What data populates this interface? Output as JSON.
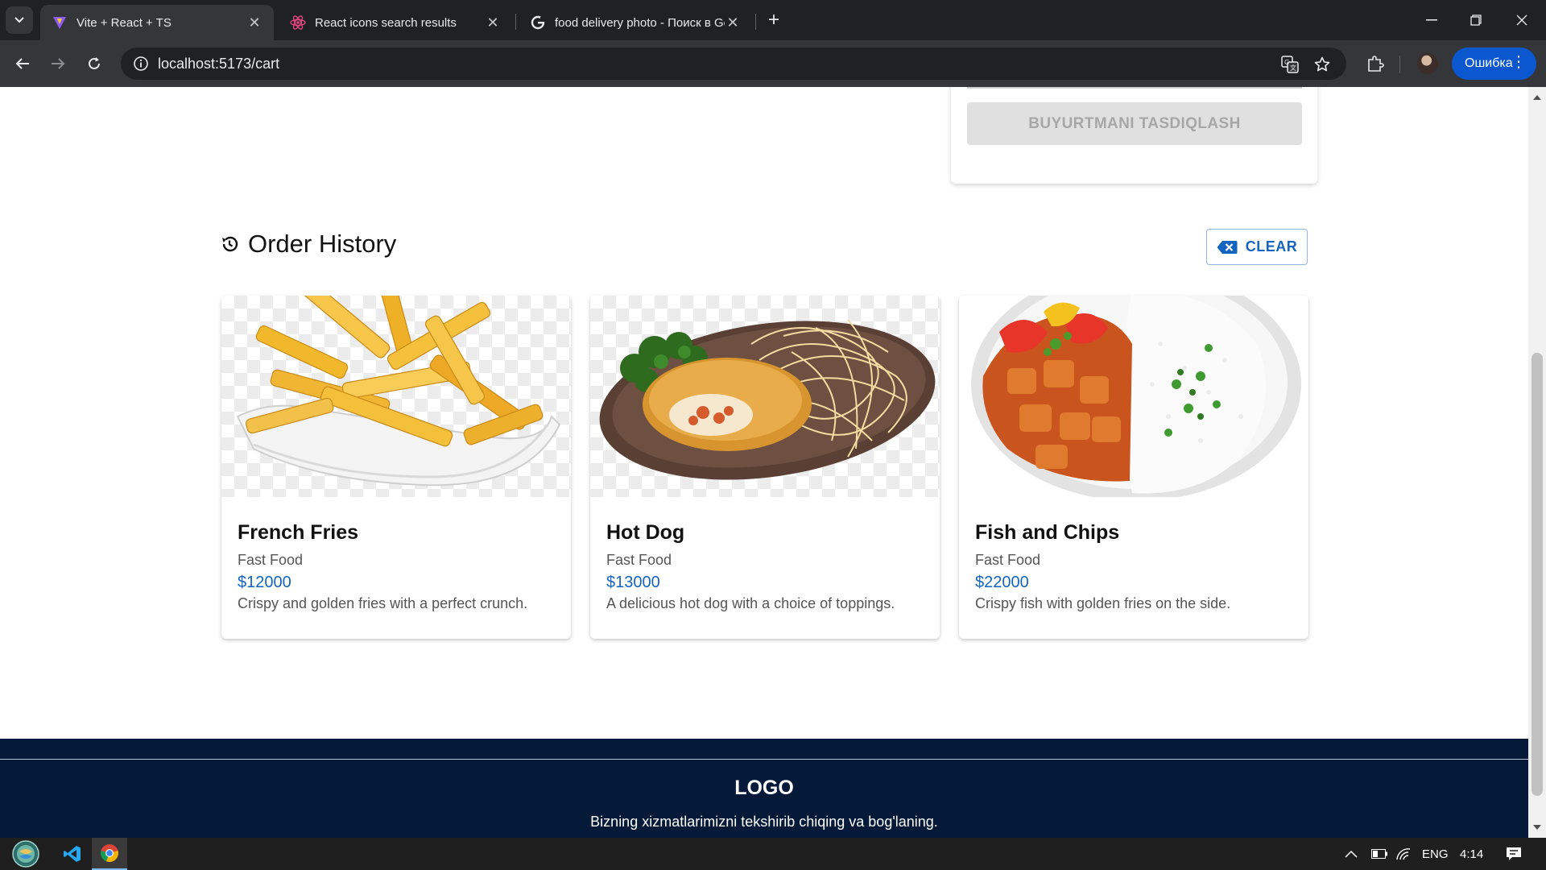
{
  "browser": {
    "tabs": [
      {
        "title": "Vite + React + TS",
        "active": true
      },
      {
        "title": "React icons search results",
        "active": false
      },
      {
        "title": "food delivery photo - Поиск в Google",
        "active": false
      }
    ],
    "url": "localhost:5173/cart",
    "profile_button": "Ошибка"
  },
  "summary": {
    "confirm_label": "BUYURTMANI TASDIQLASH"
  },
  "history": {
    "title": "Order History",
    "clear_label": "CLEAR",
    "items": [
      {
        "name": "French Fries",
        "category": "Fast Food",
        "price": "$12000",
        "description": "Crispy and golden fries with a perfect crunch."
      },
      {
        "name": "Hot Dog",
        "category": "Fast Food",
        "price": "$13000",
        "description": "A delicious hot dog with a choice of toppings."
      },
      {
        "name": "Fish and Chips",
        "category": "Fast Food",
        "price": "$22000",
        "description": "Crispy fish with golden fries on the side."
      }
    ]
  },
  "footer": {
    "logo": "LOGO",
    "tagline": "Bizning xizmatlarimizni tekshirib chiqing va bog'laning."
  },
  "taskbar": {
    "language": "ENG",
    "time": "4:14"
  },
  "colors": {
    "accent": "#1565c0",
    "footer_bg": "#041a38",
    "chrome_dark": "#202124",
    "chrome_toolbar": "#35363a",
    "error_pill": "#0b57d0"
  }
}
